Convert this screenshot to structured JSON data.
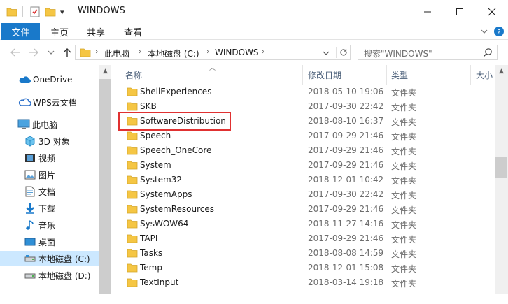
{
  "window": {
    "title": "WINDOWS",
    "quick_access_dropdown": "▾"
  },
  "ribbon": {
    "file_tab": "文件",
    "tabs": [
      "主页",
      "共享",
      "查看"
    ]
  },
  "address": {
    "crumbs": [
      "此电脑",
      "本地磁盘 (C:)",
      "WINDOWS"
    ]
  },
  "search": {
    "placeholder": "搜索\"WINDOWS\""
  },
  "sidebar": {
    "items": [
      {
        "label": "OneDrive",
        "icon": "cloud-icon"
      },
      {
        "label": "WPS云文档",
        "icon": "wps-cloud-icon"
      },
      {
        "label": "此电脑",
        "icon": "computer-icon"
      },
      {
        "label": "3D 对象",
        "icon": "cube-3d-icon"
      },
      {
        "label": "视频",
        "icon": "video-icon"
      },
      {
        "label": "图片",
        "icon": "pictures-icon"
      },
      {
        "label": "文档",
        "icon": "documents-icon"
      },
      {
        "label": "下载",
        "icon": "download-icon"
      },
      {
        "label": "音乐",
        "icon": "music-icon"
      },
      {
        "label": "桌面",
        "icon": "desktop-icon"
      },
      {
        "label": "本地磁盘 (C:)",
        "icon": "drive-c-icon",
        "selected": true
      },
      {
        "label": "本地磁盘 (D:)",
        "icon": "drive-d-icon"
      }
    ]
  },
  "columns": {
    "name": "名称",
    "date": "修改日期",
    "type": "类型",
    "size": "大小"
  },
  "files": [
    {
      "name": "ShellExperiences",
      "date": "2018-05-10 19:06",
      "type": "文件夹"
    },
    {
      "name": "SKB",
      "date": "2017-09-30 22:42",
      "type": "文件夹"
    },
    {
      "name": "SoftwareDistribution",
      "date": "2018-08-10 16:37",
      "type": "文件夹",
      "highlighted": true
    },
    {
      "name": "Speech",
      "date": "2017-09-29 21:46",
      "type": "文件夹"
    },
    {
      "name": "Speech_OneCore",
      "date": "2017-09-29 21:46",
      "type": "文件夹"
    },
    {
      "name": "System",
      "date": "2017-09-29 21:46",
      "type": "文件夹"
    },
    {
      "name": "System32",
      "date": "2018-12-01 10:42",
      "type": "文件夹"
    },
    {
      "name": "SystemApps",
      "date": "2017-09-30 22:42",
      "type": "文件夹"
    },
    {
      "name": "SystemResources",
      "date": "2017-09-29 21:46",
      "type": "文件夹"
    },
    {
      "name": "SysWOW64",
      "date": "2018-11-27 14:16",
      "type": "文件夹"
    },
    {
      "name": "TAPI",
      "date": "2017-09-29 21:46",
      "type": "文件夹"
    },
    {
      "name": "Tasks",
      "date": "2018-08-08 14:59",
      "type": "文件夹"
    },
    {
      "name": "Temp",
      "date": "2018-12-01 15:08",
      "type": "文件夹"
    },
    {
      "name": "TextInput",
      "date": "2018-03-14 19:18",
      "type": "文件夹"
    }
  ],
  "colors": {
    "accent": "#1979ca",
    "selected_bg": "#cce8ff",
    "folder": "#f5c644",
    "highlight_border": "#e03131"
  }
}
